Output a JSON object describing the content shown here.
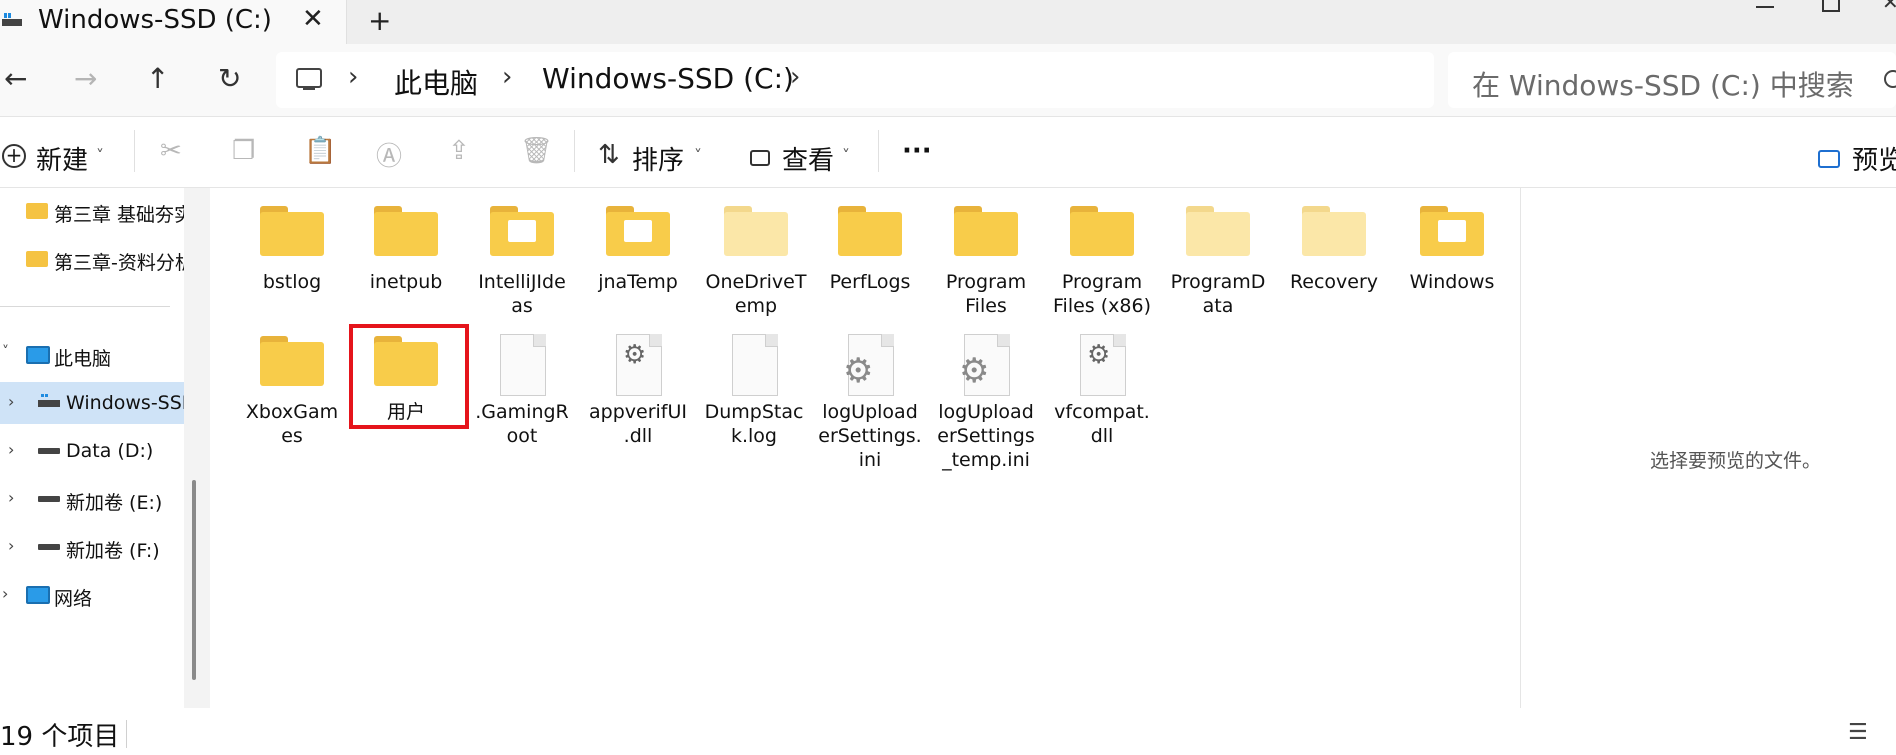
{
  "tab": {
    "title": "Windows-SSD (C:)",
    "close": "✕",
    "new_tab": "+"
  },
  "window": {
    "close": "✕"
  },
  "nav": {
    "back": "←",
    "forward": "→",
    "up": "↑",
    "refresh": "↻"
  },
  "address": {
    "chev": "›",
    "crumbs": [
      "此电脑",
      "Windows-SSD (C:)"
    ]
  },
  "search": {
    "placeholder": "在 Windows-SSD (C:) 中搜索"
  },
  "commands": {
    "new": "新建",
    "sort": "排序",
    "view": "查看",
    "more": "···",
    "preview": "预览"
  },
  "sidebar": {
    "quick": [
      "第三章 基础夯实",
      "第三章-资料分析"
    ],
    "this_pc": "此电脑",
    "drives": [
      "Windows-SSD (C:)",
      "Data (D:)",
      "新加卷 (E:)",
      "新加卷 (F:)"
    ],
    "network": "网络"
  },
  "items": [
    {
      "label": "bstlog"
    },
    {
      "label": "inetpub"
    },
    {
      "label": "IntelliJIde\nas"
    },
    {
      "label": "jnaTemp"
    },
    {
      "label": "OneDriveT\nemp"
    },
    {
      "label": "PerfLogs"
    },
    {
      "label": "Program\nFiles"
    },
    {
      "label": "Program\nFiles (x86)"
    },
    {
      "label": "ProgramD\nata"
    },
    {
      "label": "Recovery"
    },
    {
      "label": "Windows"
    },
    {
      "label": "XboxGam\nes"
    },
    {
      "label": "用户"
    },
    {
      "label": ".GamingR\noot"
    },
    {
      "label": "appverifUI\n.dll"
    },
    {
      "label": "DumpStac\nk.log"
    },
    {
      "label": "logUpload\nerSettings.\nini"
    },
    {
      "label": "logUpload\nerSettings\n_temp.ini"
    },
    {
      "label": "vfcompat.\ndll"
    }
  ],
  "preview": {
    "empty_text": "选择要预览的文件。"
  },
  "status": {
    "count": "19 个项目",
    "details_icon": "☰"
  }
}
